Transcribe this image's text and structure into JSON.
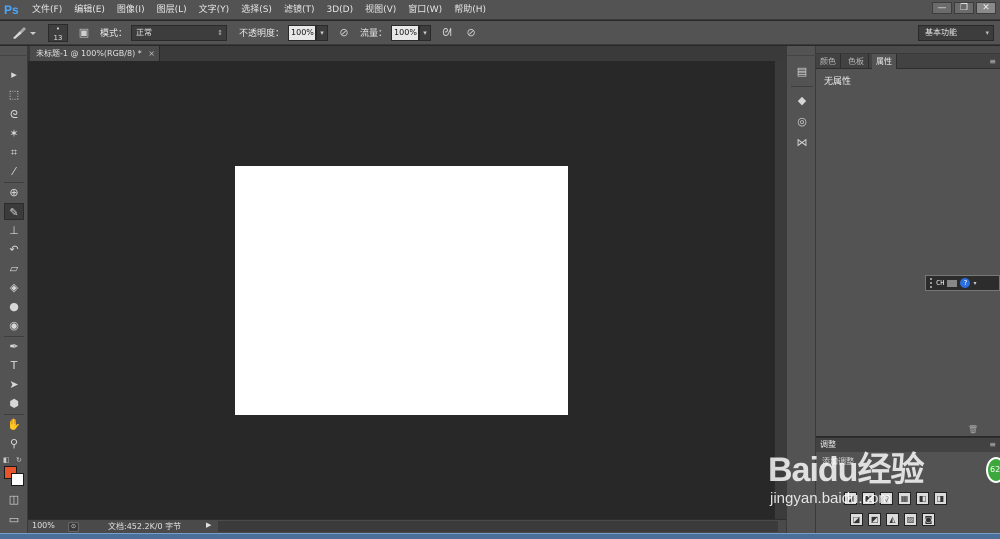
{
  "app": {
    "logo_text": "Ps",
    "menu": [
      "文件(F)",
      "编辑(E)",
      "图像(I)",
      "图层(L)",
      "文字(Y)",
      "选择(S)",
      "滤镜(T)",
      "3D(D)",
      "视图(V)",
      "窗口(W)",
      "帮助(H)"
    ],
    "window_controls": {
      "minimize": "—",
      "restore": "❐",
      "close": "✕"
    }
  },
  "options_bar": {
    "brush_size": "13",
    "mode_label": "模式：",
    "mode_value": "正常",
    "opacity_label": "不透明度：",
    "opacity_value": "100%",
    "flow_label": "流量：",
    "flow_value": "100%",
    "workspace_value": "基本功能"
  },
  "document": {
    "tab_title": "未标题-1 @ 100%(RGB/8) *",
    "tab_close": "×"
  },
  "status_bar": {
    "zoom": "100%",
    "doc_info": "文档:452.2K/0 字节"
  },
  "right_panel": {
    "tabs": [
      "颜色",
      "色板",
      "属性"
    ],
    "active_tab": "属性",
    "body_title": "无属性"
  },
  "adjustments_panel": {
    "tab_label": "调整",
    "add_label": "添加调整"
  },
  "ime": {
    "mode_text": "CH",
    "help_text": "?"
  },
  "badge": {
    "text": "62"
  },
  "watermark": {
    "brand": "Baidu经验",
    "url": "jingyan.baidu.com"
  },
  "colors": {
    "foreground": "#e8542c",
    "background": "#ffffff",
    "accent_logo": "#4aa6ff"
  }
}
